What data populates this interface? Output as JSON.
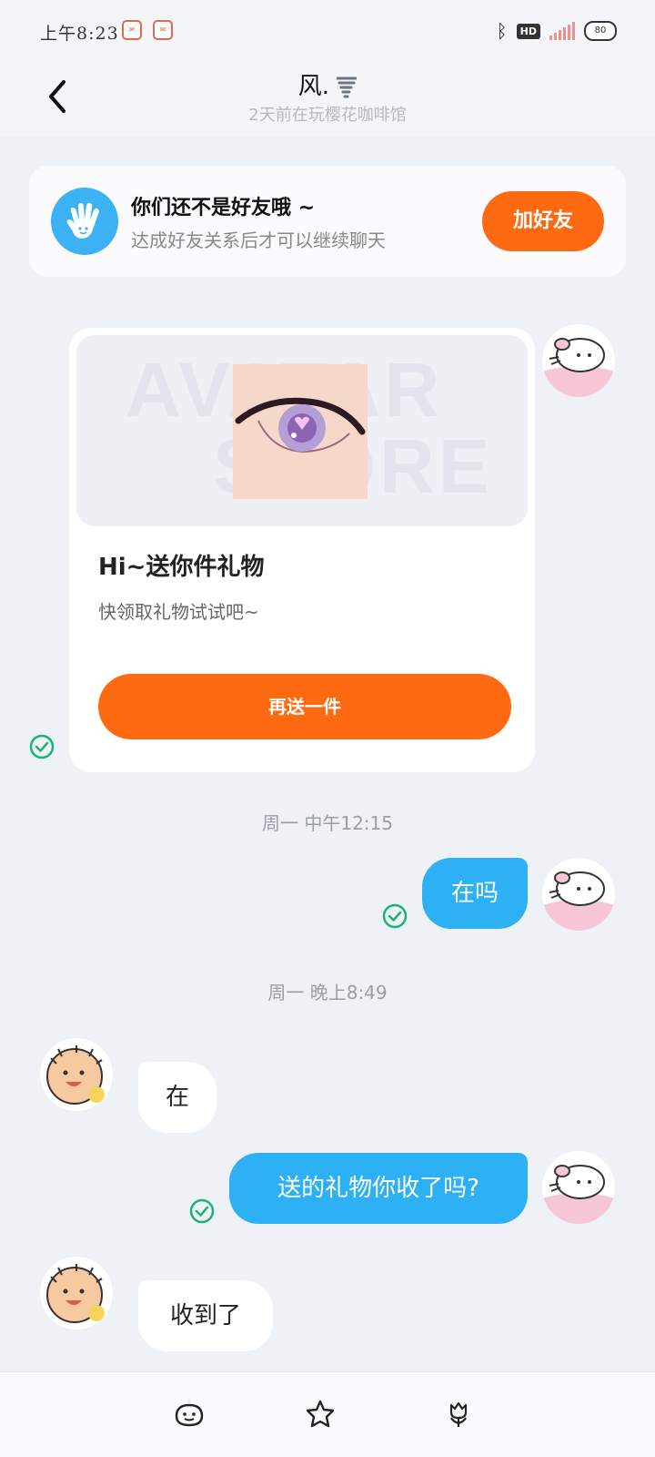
{
  "status_bar": {
    "time": "上午8:23",
    "hd_label": "HD",
    "battery_label": "80"
  },
  "header": {
    "title": "风.",
    "subtitle": "2天前在玩樱花咖啡馆"
  },
  "friend_banner": {
    "title": "你们还不是好友哦 ~",
    "subtitle": "达成好友关系后才可以继续聊天",
    "add_button_label": "加好友"
  },
  "gift_card": {
    "watermark_line1": "AVATAR",
    "watermark_line2": "STORE",
    "title": "Hi~送你件礼物",
    "description": "快领取礼物试试吧~",
    "button_label": "再送一件"
  },
  "timestamps": [
    "周一 中午12:15",
    "周一 晚上8:49"
  ],
  "messages": [
    {
      "direction": "out",
      "text": "在吗"
    },
    {
      "direction": "in",
      "text": "在"
    },
    {
      "direction": "out",
      "text": "送的礼物你收了吗?"
    },
    {
      "direction": "in",
      "text": "收到了"
    }
  ],
  "bottom_bar": {
    "icons": [
      "emoji-icon",
      "star-icon",
      "flower-icon"
    ]
  },
  "colors": {
    "accent_orange": "#fe6a12",
    "bubble_blue": "#2db1f4",
    "check_green": "#19b374",
    "background": "#eef1f6"
  }
}
